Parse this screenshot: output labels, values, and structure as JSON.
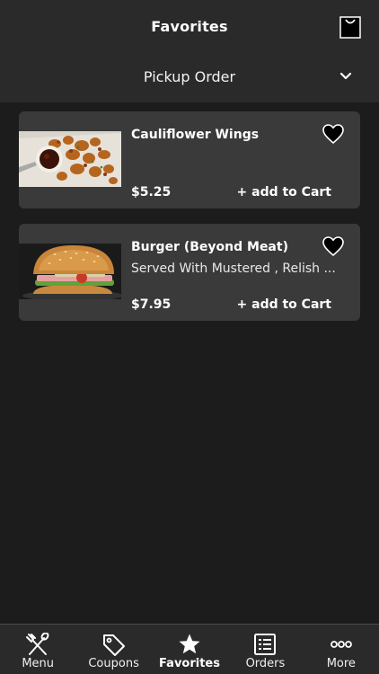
{
  "header": {
    "title": "Favorites",
    "cart_icon": "shopping-bag-icon"
  },
  "order_type": {
    "label": "Pickup Order",
    "icon": "chevron-down-icon"
  },
  "favorites": [
    {
      "name": "Cauliflower Wings",
      "description": "",
      "price": "$5.25",
      "add_label": "+ add to Cart",
      "favorited": true
    },
    {
      "name": "Burger (Beyond Meat)",
      "description": "Served With Mustered , Relish ...",
      "price": "$7.95",
      "add_label": "+ add to Cart",
      "favorited": true
    }
  ],
  "tabbar": {
    "active": "Favorites",
    "tabs": [
      {
        "label": "Menu",
        "icon": "utensils-icon"
      },
      {
        "label": "Coupons",
        "icon": "tag-icon"
      },
      {
        "label": "Favorites",
        "icon": "star-icon"
      },
      {
        "label": "Orders",
        "icon": "list-icon"
      },
      {
        "label": "More",
        "icon": "more-icon"
      }
    ]
  },
  "colors": {
    "background": "#1c1c1c",
    "header": "#2a2a2a",
    "card": "#3a3a3a",
    "text": "#ffffff"
  }
}
